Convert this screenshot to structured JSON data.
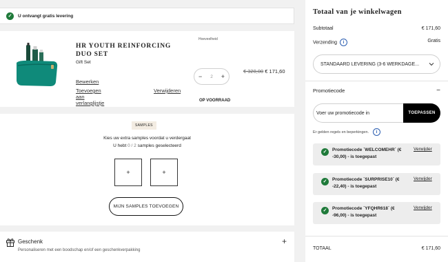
{
  "notice": {
    "text": "U ontvangt gratis levering"
  },
  "product": {
    "name": "HR YOUTH REINFORCING DUO SET",
    "subtitle": "Gift Set",
    "quantity_label": "Hoeveelheid",
    "quantity": "2",
    "minus": "−",
    "plus": "+",
    "old_price": "€ 320,00",
    "new_price": "€ 171,60",
    "status": "OP VOORRAAD",
    "edit_link": "Bewerken",
    "wishlist_link": "Toevoegen aan verlanglijstje",
    "remove_link": "Verwijderen"
  },
  "samples": {
    "badge": "SAMPLES",
    "line1": "Kies uw extra samples voordat u verdergaat",
    "line2_prefix": "U hebt",
    "line2_count": "0 / 2",
    "line2_suffix": "samples geselecteerd",
    "slot_symbol": "+",
    "button": "MIJN SAMPLES TOEVOEGEN"
  },
  "gift": {
    "title": "Geschenk",
    "subtitle": "Personaliseren met een boodschap en/of een geschenkverpakking",
    "toggle": "+"
  },
  "summary": {
    "title": "Totaal van je winkelwagen",
    "subtotal_label": "Subtotaal",
    "subtotal_value": "€ 171,60",
    "shipping_label": "Verzending",
    "shipping_value": "Gratis",
    "shipping_option": "STANDAARD LEVERING (3-6 WERKDAGE...",
    "promo_label": "Promotiecode",
    "promo_toggle": "−",
    "promo_placeholder": "Voer uw promotiecode in",
    "promo_apply": "TOEPASSEN",
    "rules_text": "Er gelden regels en beperkingen.",
    "codes": [
      {
        "text": "Promotiecode `WELCOMEHR` (€ -30,00) - is toegepast",
        "remove": "Verwijder"
      },
      {
        "text": "Promotiecode `SURPRISE10` (€ -22,40) - is toegepast",
        "remove": "Verwijder"
      },
      {
        "text": "Promotiecode `YFQHR618` (€ -96,00) - is toegepast",
        "remove": "Verwijder"
      }
    ],
    "total_label": "TOTAAL",
    "total_value": "€ 171,60"
  },
  "colors": {
    "success": "#1f7a3a",
    "info": "#2a5db0",
    "product_green": "#14806a",
    "badge_bg": "#f3ece2"
  },
  "icons": {
    "notice": "check-circle-icon",
    "info": "info-icon",
    "gift": "gift-icon",
    "dropdown": "chevron-down-icon"
  }
}
